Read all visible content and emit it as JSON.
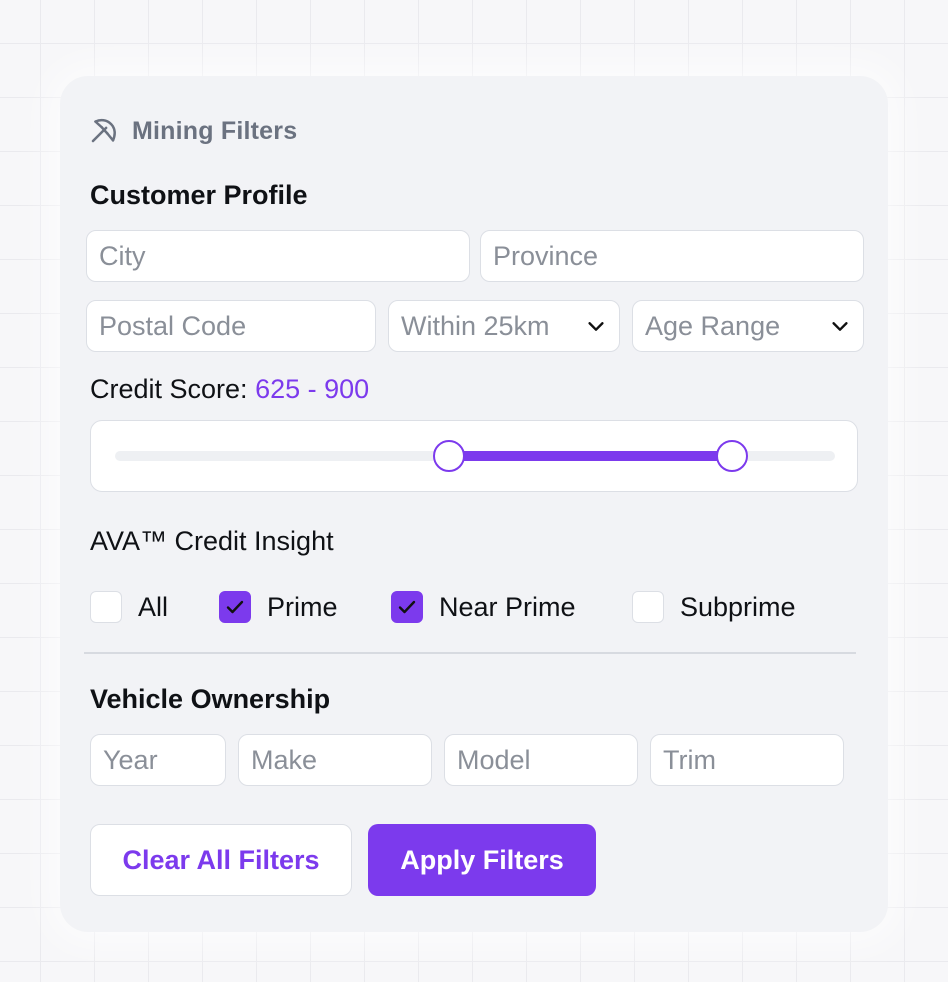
{
  "header": {
    "title": "Mining Filters",
    "icon": "pickaxe-icon"
  },
  "customer_profile": {
    "title": "Customer Profile",
    "city_placeholder": "City",
    "province_placeholder": "Province",
    "postal_placeholder": "Postal Code",
    "distance_value": "Within 25km",
    "age_value": "Age Range"
  },
  "credit_score": {
    "label": "Credit Score:",
    "range_text": "625 - 900",
    "min": 300,
    "max": 1000,
    "low": 625,
    "high": 900
  },
  "insight": {
    "title": "AVA™ Credit Insight",
    "options": [
      {
        "label": "All",
        "checked": false
      },
      {
        "label": "Prime",
        "checked": true
      },
      {
        "label": "Near Prime",
        "checked": true
      },
      {
        "label": "Subprime",
        "checked": false
      }
    ]
  },
  "vehicle": {
    "title": "Vehicle Ownership",
    "year_placeholder": "Year",
    "make_placeholder": "Make",
    "model_placeholder": "Model",
    "trim_placeholder": "Trim"
  },
  "actions": {
    "clear_label": "Clear All Filters",
    "apply_label": "Apply Filters"
  },
  "colors": {
    "accent": "#7c3aed",
    "panel": "#f2f3f6"
  }
}
